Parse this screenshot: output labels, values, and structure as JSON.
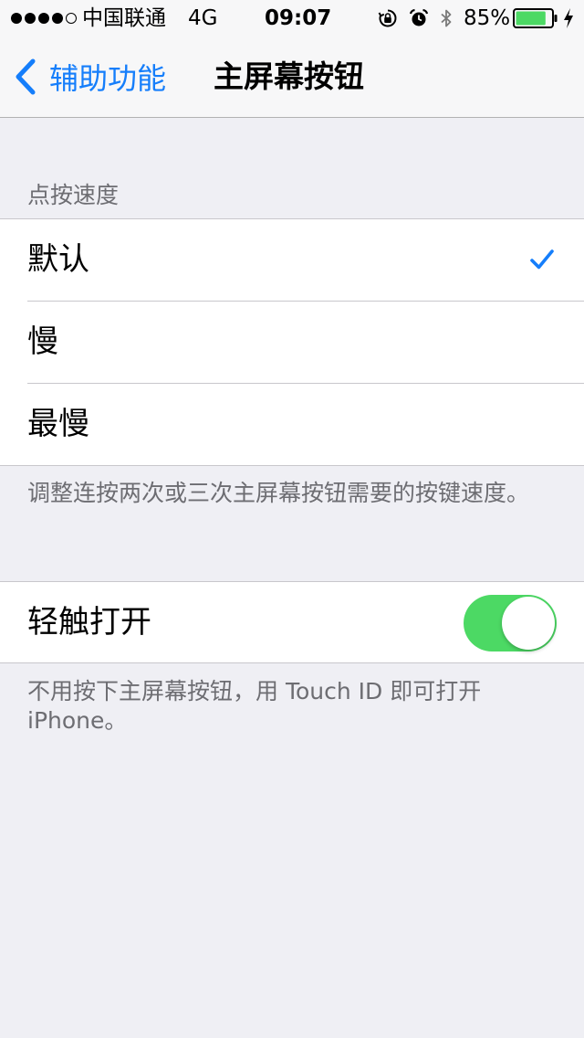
{
  "status_bar": {
    "carrier": "中国联通",
    "network": "4G",
    "time": "09:07",
    "battery_percent": "85%",
    "battery_level": 0.85,
    "signal_bars_filled": 4,
    "signal_bars_total": 5
  },
  "nav": {
    "back_label": "辅助功能",
    "title": "主屏幕按钮"
  },
  "click_speed": {
    "header": "点按速度",
    "options": [
      {
        "label": "默认",
        "selected": true
      },
      {
        "label": "慢",
        "selected": false
      },
      {
        "label": "最慢",
        "selected": false
      }
    ],
    "footer": "调整连按两次或三次主屏幕按钮需要的按键速度。"
  },
  "rest_finger": {
    "label": "轻触打开",
    "enabled": true,
    "footer": "不用按下主屏幕按钮，用 Touch ID 即可打开 iPhone。"
  },
  "colors": {
    "accent": "#157efb",
    "toggle_on": "#4cd964",
    "battery": "#4cd964",
    "background": "#efeff4",
    "secondary_text": "#6d6d72"
  },
  "icons": {
    "back": "chevron-left-icon",
    "check": "checkmark-icon",
    "lock": "orientation-lock-icon",
    "alarm": "alarm-icon",
    "bluetooth": "bluetooth-icon",
    "battery": "battery-icon",
    "charging": "charging-bolt-icon"
  }
}
